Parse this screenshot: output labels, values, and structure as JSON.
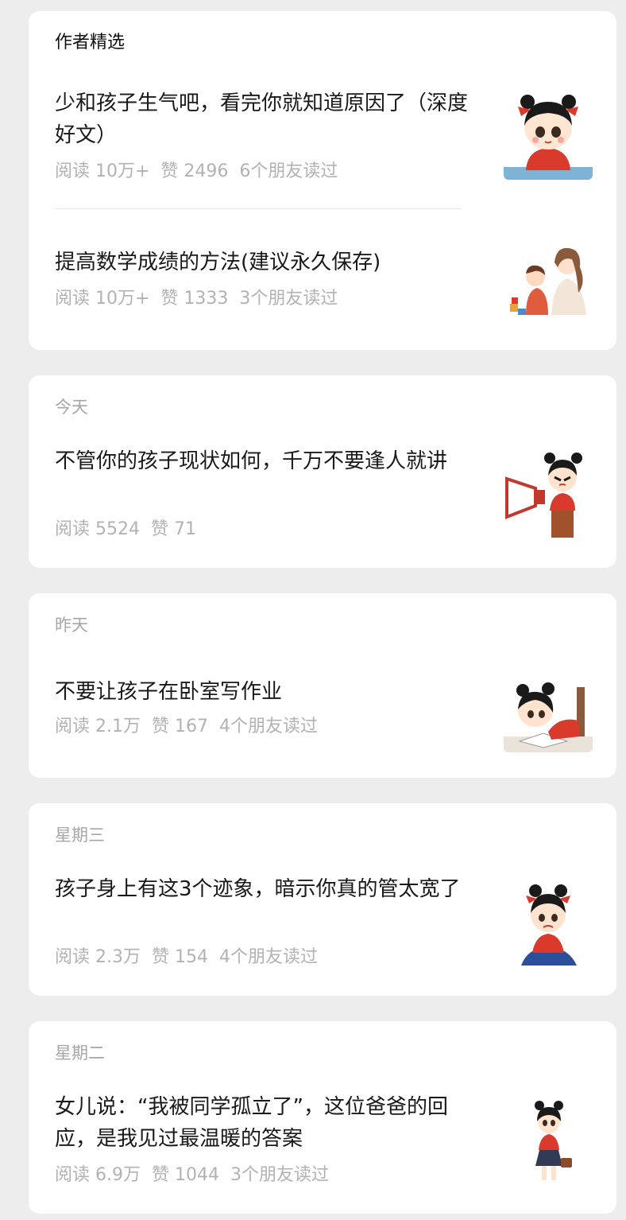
{
  "featured": {
    "title": "作者精选",
    "articles": [
      {
        "title": "少和孩子生气吧，看完你就知道原因了（深度好文）",
        "reads": "阅读 10万+",
        "likes": "赞 2496",
        "friends": "6个朋友读过",
        "thumb_icon": "girl-at-table-illustration"
      },
      {
        "title": "提高数学成绩的方法(建议永久保存)",
        "reads": "阅读 10万+",
        "likes": "赞 1333",
        "friends": "3个朋友读过",
        "thumb_icon": "mother-and-child-illustration"
      }
    ]
  },
  "groups": [
    {
      "date": "今天",
      "article": {
        "title": "不管你的孩子现状如何，千万不要逢人就讲",
        "reads": "阅读 5524",
        "likes": "赞 71",
        "friends": "",
        "thumb_icon": "girl-with-megaphone-illustration"
      }
    },
    {
      "date": "昨天",
      "article": {
        "title": "不要让孩子在卧室写作业",
        "reads": "阅读 2.1万",
        "likes": "赞 167",
        "friends": "4个朋友读过",
        "thumb_icon": "girl-doing-homework-illustration"
      }
    },
    {
      "date": "星期三",
      "article": {
        "title": "孩子身上有这3个迹象，暗示你真的管太宽了",
        "reads": "阅读 2.3万",
        "likes": "赞 154",
        "friends": "4个朋友读过",
        "thumb_icon": "sad-girl-sitting-illustration"
      }
    },
    {
      "date": "星期二",
      "article": {
        "title": "女儿说：“我被同学孤立了”，这位爸爸的回应，是我见过最温暖的答案",
        "reads": "阅读 6.9万",
        "likes": "赞 1044",
        "friends": "3个朋友读过",
        "thumb_icon": "girl-with-bag-illustration"
      }
    }
  ],
  "colors": {
    "background": "#ededed",
    "card": "#ffffff",
    "meta_text": "#b2b2b2",
    "title_text": "#191919",
    "accent_red": "#d93a2b"
  }
}
